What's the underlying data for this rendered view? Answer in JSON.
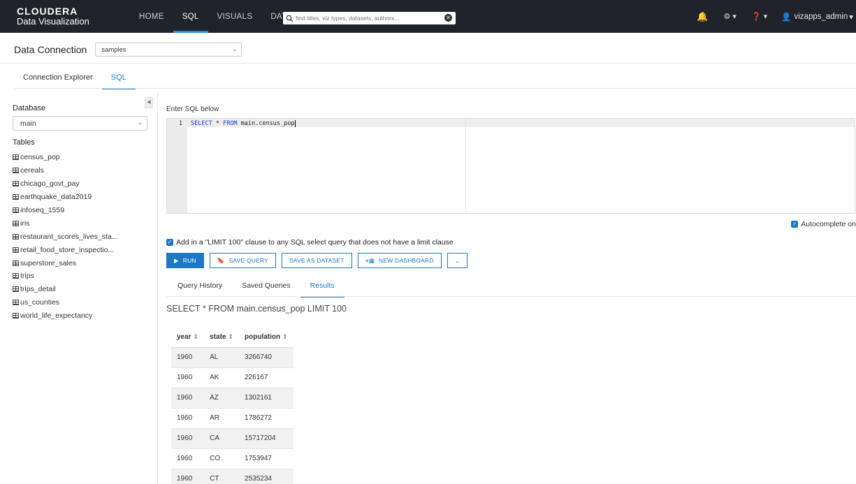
{
  "brand": {
    "line1": "CLOUDERA",
    "line2": "Data Visualization"
  },
  "nav": {
    "items": [
      "HOME",
      "SQL",
      "VISUALS",
      "DATA"
    ],
    "active": "SQL"
  },
  "search": {
    "placeholder": "find titles, viz types, datasets, authors..."
  },
  "user": {
    "name": "vizapps_admin"
  },
  "data_connection": {
    "title": "Data Connection",
    "selected": "samples"
  },
  "main_tabs": {
    "items": [
      "Connection Explorer",
      "SQL"
    ],
    "active": "SQL"
  },
  "sidebar": {
    "database_label": "Database",
    "database_selected": "main",
    "tables_label": "Tables",
    "tables": [
      "census_pop",
      "cereals",
      "chicago_govt_pay",
      "earthquake_data2019",
      "infoseq_1559",
      "iris",
      "restaurant_scores_lives_sta...",
      "retail_food_store_inspectio...",
      "superstore_sales",
      "trips",
      "trips_detail",
      "us_counties",
      "world_life_expectancy"
    ]
  },
  "editor": {
    "label": "Enter SQL below",
    "line_number": "1",
    "kw1": "SELECT",
    "op": " * ",
    "kw2": "FROM",
    "rest": " main.census_pop"
  },
  "autocomplete": {
    "label": "Autocomplete on"
  },
  "limit_option": {
    "label": "Add in a \"LIMIT 100\" clause to any SQL select query that does not have a limit clause"
  },
  "buttons": {
    "run": "RUN",
    "save_query": "SAVE QUERY",
    "save_dataset": "SAVE AS DATASET",
    "new_dashboard": "NEW DASHBOARD"
  },
  "result_tabs": {
    "items": [
      "Query History",
      "Saved Queries",
      "Results"
    ],
    "active": "Results"
  },
  "results": {
    "query_text": "SELECT * FROM main.census_pop LIMIT 100",
    "columns": [
      "year",
      "state",
      "population"
    ],
    "rows": [
      [
        "1960",
        "AL",
        "3266740"
      ],
      [
        "1960",
        "AK",
        "226167"
      ],
      [
        "1960",
        "AZ",
        "1302161"
      ],
      [
        "1960",
        "AR",
        "1786272"
      ],
      [
        "1960",
        "CA",
        "15717204"
      ],
      [
        "1960",
        "CO",
        "1753947"
      ],
      [
        "1960",
        "CT",
        "2535234"
      ]
    ]
  },
  "colors": {
    "accent": "#1d79c5",
    "topbar": "#20242a",
    "bell": "#f2a93b"
  }
}
